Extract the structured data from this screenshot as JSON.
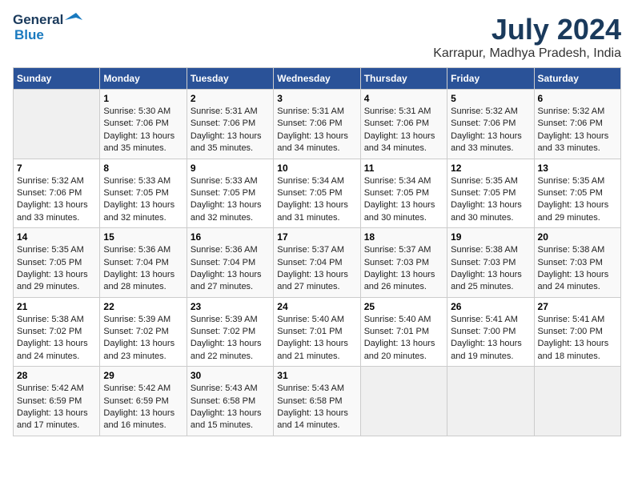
{
  "logo": {
    "line1": "General",
    "line2": "Blue"
  },
  "title": "July 2024",
  "subtitle": "Karrapur, Madhya Pradesh, India",
  "days_of_week": [
    "Sunday",
    "Monday",
    "Tuesday",
    "Wednesday",
    "Thursday",
    "Friday",
    "Saturday"
  ],
  "weeks": [
    [
      {
        "day": "",
        "info": ""
      },
      {
        "day": "1",
        "info": "Sunrise: 5:30 AM\nSunset: 7:06 PM\nDaylight: 13 hours\nand 35 minutes."
      },
      {
        "day": "2",
        "info": "Sunrise: 5:31 AM\nSunset: 7:06 PM\nDaylight: 13 hours\nand 35 minutes."
      },
      {
        "day": "3",
        "info": "Sunrise: 5:31 AM\nSunset: 7:06 PM\nDaylight: 13 hours\nand 34 minutes."
      },
      {
        "day": "4",
        "info": "Sunrise: 5:31 AM\nSunset: 7:06 PM\nDaylight: 13 hours\nand 34 minutes."
      },
      {
        "day": "5",
        "info": "Sunrise: 5:32 AM\nSunset: 7:06 PM\nDaylight: 13 hours\nand 33 minutes."
      },
      {
        "day": "6",
        "info": "Sunrise: 5:32 AM\nSunset: 7:06 PM\nDaylight: 13 hours\nand 33 minutes."
      }
    ],
    [
      {
        "day": "7",
        "info": "Sunrise: 5:32 AM\nSunset: 7:06 PM\nDaylight: 13 hours\nand 33 minutes."
      },
      {
        "day": "8",
        "info": "Sunrise: 5:33 AM\nSunset: 7:05 PM\nDaylight: 13 hours\nand 32 minutes."
      },
      {
        "day": "9",
        "info": "Sunrise: 5:33 AM\nSunset: 7:05 PM\nDaylight: 13 hours\nand 32 minutes."
      },
      {
        "day": "10",
        "info": "Sunrise: 5:34 AM\nSunset: 7:05 PM\nDaylight: 13 hours\nand 31 minutes."
      },
      {
        "day": "11",
        "info": "Sunrise: 5:34 AM\nSunset: 7:05 PM\nDaylight: 13 hours\nand 30 minutes."
      },
      {
        "day": "12",
        "info": "Sunrise: 5:35 AM\nSunset: 7:05 PM\nDaylight: 13 hours\nand 30 minutes."
      },
      {
        "day": "13",
        "info": "Sunrise: 5:35 AM\nSunset: 7:05 PM\nDaylight: 13 hours\nand 29 minutes."
      }
    ],
    [
      {
        "day": "14",
        "info": "Sunrise: 5:35 AM\nSunset: 7:05 PM\nDaylight: 13 hours\nand 29 minutes."
      },
      {
        "day": "15",
        "info": "Sunrise: 5:36 AM\nSunset: 7:04 PM\nDaylight: 13 hours\nand 28 minutes."
      },
      {
        "day": "16",
        "info": "Sunrise: 5:36 AM\nSunset: 7:04 PM\nDaylight: 13 hours\nand 27 minutes."
      },
      {
        "day": "17",
        "info": "Sunrise: 5:37 AM\nSunset: 7:04 PM\nDaylight: 13 hours\nand 27 minutes."
      },
      {
        "day": "18",
        "info": "Sunrise: 5:37 AM\nSunset: 7:03 PM\nDaylight: 13 hours\nand 26 minutes."
      },
      {
        "day": "19",
        "info": "Sunrise: 5:38 AM\nSunset: 7:03 PM\nDaylight: 13 hours\nand 25 minutes."
      },
      {
        "day": "20",
        "info": "Sunrise: 5:38 AM\nSunset: 7:03 PM\nDaylight: 13 hours\nand 24 minutes."
      }
    ],
    [
      {
        "day": "21",
        "info": "Sunrise: 5:38 AM\nSunset: 7:02 PM\nDaylight: 13 hours\nand 24 minutes."
      },
      {
        "day": "22",
        "info": "Sunrise: 5:39 AM\nSunset: 7:02 PM\nDaylight: 13 hours\nand 23 minutes."
      },
      {
        "day": "23",
        "info": "Sunrise: 5:39 AM\nSunset: 7:02 PM\nDaylight: 13 hours\nand 22 minutes."
      },
      {
        "day": "24",
        "info": "Sunrise: 5:40 AM\nSunset: 7:01 PM\nDaylight: 13 hours\nand 21 minutes."
      },
      {
        "day": "25",
        "info": "Sunrise: 5:40 AM\nSunset: 7:01 PM\nDaylight: 13 hours\nand 20 minutes."
      },
      {
        "day": "26",
        "info": "Sunrise: 5:41 AM\nSunset: 7:00 PM\nDaylight: 13 hours\nand 19 minutes."
      },
      {
        "day": "27",
        "info": "Sunrise: 5:41 AM\nSunset: 7:00 PM\nDaylight: 13 hours\nand 18 minutes."
      }
    ],
    [
      {
        "day": "28",
        "info": "Sunrise: 5:42 AM\nSunset: 6:59 PM\nDaylight: 13 hours\nand 17 minutes."
      },
      {
        "day": "29",
        "info": "Sunrise: 5:42 AM\nSunset: 6:59 PM\nDaylight: 13 hours\nand 16 minutes."
      },
      {
        "day": "30",
        "info": "Sunrise: 5:43 AM\nSunset: 6:58 PM\nDaylight: 13 hours\nand 15 minutes."
      },
      {
        "day": "31",
        "info": "Sunrise: 5:43 AM\nSunset: 6:58 PM\nDaylight: 13 hours\nand 14 minutes."
      },
      {
        "day": "",
        "info": ""
      },
      {
        "day": "",
        "info": ""
      },
      {
        "day": "",
        "info": ""
      }
    ]
  ]
}
